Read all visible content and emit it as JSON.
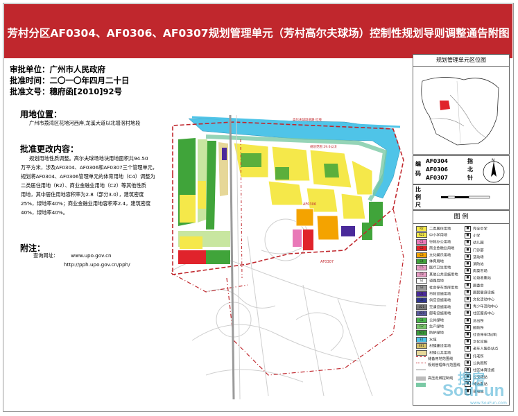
{
  "title": "芳村分区AF0304、AF0306、AF0307规划管理单元（芳村高尔夫球场）控制性规划导则调整通告附图",
  "approval": {
    "unit_label": "审批单位：",
    "unit_value": "广州市人民政府",
    "time_label": "批准时间：",
    "time_value": "二〇一〇年四月二十日",
    "doc_label": "批准文号：",
    "doc_value": "穗府函[2010]92号"
  },
  "location": {
    "heading": "用地位置：",
    "text": "广州市荔湾区花地河西岸,龙溪大道以北增滘村地段"
  },
  "changes": {
    "heading": "批准更改内容：",
    "lines": [
      "规划用地性质调整。高尔夫球场地块用地面积共94.50",
      "万平方米，涉及AF0304、AF0306和AF0307三个管理单元，",
      "规划将AF0304、AF0306管理单元的体育用地（C4）调整为",
      "二类居住用地（R2）、商业金融业用地（C2）等其他性质",
      "用地，其中居住用地容积率为2.8（部分3.0），建筑密度",
      "25%，绿地率40%；商业金融业用地容积率2.4，建筑密度",
      "40%，绿地率40%。"
    ]
  },
  "notes": {
    "heading": "附注：",
    "query_label": "查询网址：",
    "url1": "www.upo.gov.cn",
    "url2": "http://pph.upo.gov.cn/pph/"
  },
  "map_labels": {
    "river1": "高尔夫球场道路 红线",
    "river2": "规划范围 29.6公顷",
    "unit_af0306": "AF0306",
    "unit_af0307": "AF0307"
  },
  "location_map": {
    "heading": "规划管理单元区位图"
  },
  "codes": {
    "label1": "编",
    "label2": "码",
    "values": [
      "AF0304",
      "AF0306",
      "AF0307"
    ],
    "north1": "指",
    "north2": "北",
    "north3": "针",
    "north_letter": "N"
  },
  "scale": {
    "label1": "比",
    "label2": "例",
    "label3": "尺"
  },
  "legend": {
    "heading": "图   例",
    "land_items": [
      {
        "code": "R2",
        "label": "二类居住用地",
        "color": "#f5e84a"
      },
      {
        "code": "R22",
        "label": "中小学用地",
        "color": "#f5e84a"
      },
      {
        "code": "C1",
        "label": "行政办公用地",
        "color": "#e979b8"
      },
      {
        "code": "C2",
        "label": "商业金融业用地",
        "color": "#e0232b"
      },
      {
        "code": "C3",
        "label": "文化娱乐用地",
        "color": "#f4a300"
      },
      {
        "code": "C4",
        "label": "体育用地",
        "color": "#40a43a"
      },
      {
        "code": "C5",
        "label": "医疗卫生用地",
        "color": "#e89ec5"
      },
      {
        "code": "C9",
        "label": "其他公共设施用地",
        "color": "#e89ec5"
      },
      {
        "code": "S1",
        "label": "道路用地",
        "color": "#ffffff"
      },
      {
        "code": "S3",
        "label": "社会停车场库用地",
        "color": "#9a9a9a"
      },
      {
        "code": "U1",
        "label": "市政设施用地",
        "color": "#4a2a9a"
      },
      {
        "code": "U2",
        "label": "供应设施用地",
        "color": "#2e3590"
      },
      {
        "code": "U21",
        "label": "交通设施用地",
        "color": "#7a7a7a"
      },
      {
        "code": "U29",
        "label": "邮电设施用地",
        "color": "#5a5aa0"
      },
      {
        "code": "G1",
        "label": "公共绿地",
        "color": "#49b84a"
      },
      {
        "code": "G2",
        "label": "生产绿地",
        "color": "#79c86b"
      },
      {
        "code": "G22",
        "label": "防护绿地",
        "color": "#3a9a3a"
      },
      {
        "code": "E1",
        "label": "水域",
        "color": "#4fc4e8"
      },
      {
        "code": "E61",
        "label": "村镇建设用地",
        "color": "#d6c26a"
      },
      {
        "code": "",
        "label": "村镇公共用地",
        "color": "#e6d798"
      }
    ],
    "line_items": [
      {
        "label": "储备用地范围线",
        "style": "dash-red"
      },
      {
        "label": "规划管理单元范围线",
        "style": "dashdot-red"
      },
      {
        "label": "",
        "style": "gray"
      },
      {
        "label": "高压走廊控制线",
        "style": "gray-band"
      },
      {
        "label": "",
        "style": "green-band"
      }
    ],
    "icon_items": [
      {
        "label": "完全中学",
        "icon": "school-icon"
      },
      {
        "label": "小学",
        "icon": "school-icon"
      },
      {
        "label": "幼儿园",
        "icon": "kindergarten-icon"
      },
      {
        "label": "门诊部",
        "icon": "clinic-icon"
      },
      {
        "label": "活动场",
        "icon": "field-icon"
      },
      {
        "label": "消防站",
        "icon": "fire-icon"
      },
      {
        "label": "肉菜市场",
        "icon": "market-icon"
      },
      {
        "label": "垃圾收集站",
        "icon": "trash-icon"
      },
      {
        "label": "居委会",
        "icon": "office-icon"
      },
      {
        "label": "居民健身设施",
        "icon": "fitness-icon"
      },
      {
        "label": "文化活动中心",
        "icon": "culture-icon"
      },
      {
        "label": "青少年活动中心",
        "icon": "youth-icon"
      },
      {
        "label": "社区服务中心",
        "icon": "service-icon"
      },
      {
        "label": "派出所",
        "icon": "police-icon"
      },
      {
        "label": "邮政所",
        "icon": "post-icon"
      },
      {
        "label": "社会停车场(库)",
        "icon": "parking-icon"
      },
      {
        "label": "文化设施",
        "icon": "culture-icon"
      },
      {
        "label": "老年人服务站点",
        "icon": "elderly-icon"
      },
      {
        "label": "托老所",
        "icon": "elderly-icon"
      },
      {
        "label": "公共厕所",
        "icon": "toilet-icon"
      },
      {
        "label": "社区体育设施",
        "icon": "sports-icon"
      },
      {
        "label": "公交场站",
        "icon": "bus-icon"
      },
      {
        "label": "排水泵站",
        "icon": "pump-icon"
      },
      {
        "label": "变电站",
        "icon": "power-icon"
      }
    ]
  },
  "watermark": {
    "text1": "搜房",
    "text2": "SouFun",
    "url": "www.SouFun.com"
  },
  "colors": {
    "title_bg": "#c0272d",
    "residential": "#f5e84a",
    "green": "#40a43a",
    "water": "#4fc4e8",
    "commercial": "#e0232b",
    "culture": "#f4a300",
    "boundary": "#c0272d"
  }
}
